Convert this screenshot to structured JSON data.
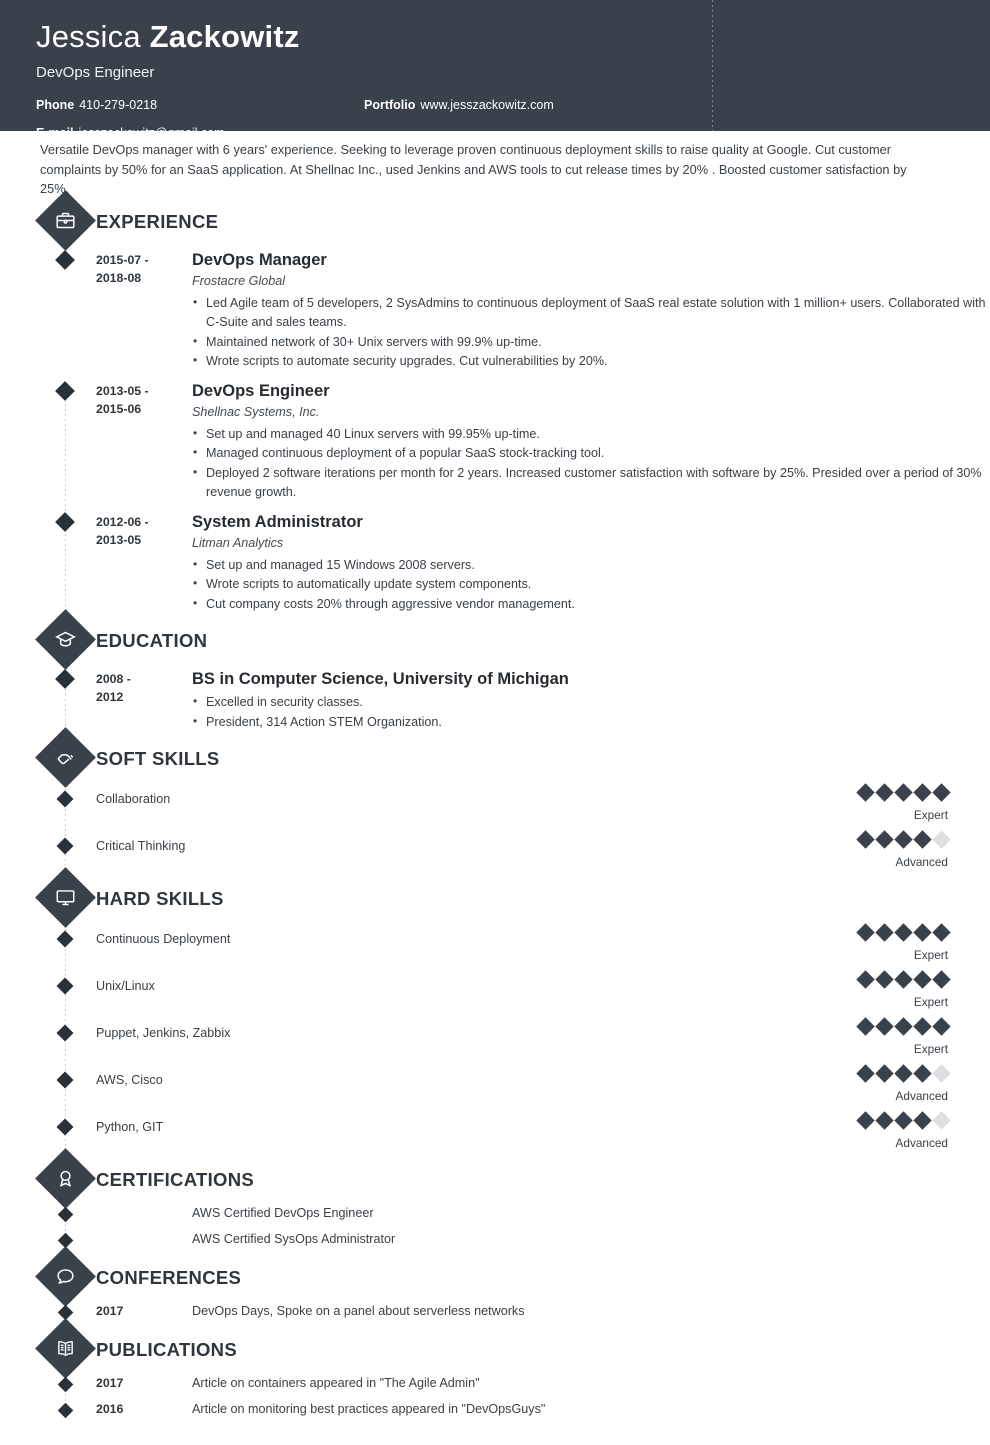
{
  "header": {
    "first_name": "Jessica ",
    "last_name": "Zackowitz",
    "job_title": "DevOps Engineer",
    "phone_label": "Phone",
    "phone_value": "410-279-0218",
    "portfolio_label": "Portfolio",
    "portfolio_value": "www.jesszackowitz.com",
    "email_label": "E-mail",
    "email_value": "jesszackowitz@gmail.com",
    "bg_color": "#39414b"
  },
  "summary": "Versatile DevOps manager with 6 years' experience. Seeking to leverage proven continuous deployment skills to raise quality at Google. Cut customer complaints by 50% for an SaaS application. At Shellnac Inc., used Jenkins and AWS tools to cut release times by 20% . Boosted customer satisfaction by 25%.",
  "sections": {
    "experience": {
      "title": "EXPERIENCE",
      "icon": "briefcase-icon",
      "entries": [
        {
          "date": "2015-07 - 2018-08",
          "role": "DevOps Manager",
          "company": "Frostacre Global",
          "points": [
            "Led Agile team of 5 developers, 2 SysAdmins to continuous deployment of SaaS real estate solution with 1 million+ users. Collaborated with C-Suite and sales teams.",
            "Maintained network of 30+ Unix servers with 99.9% up-time.",
            "Wrote scripts to automate security upgrades. Cut vulnerabilities by 20%."
          ]
        },
        {
          "date": "2013-05 - 2015-06",
          "role": "DevOps Engineer",
          "company": "Shellnac Systems, Inc.",
          "points": [
            "Set up and managed 40 Linux servers with 99.95% up-time.",
            "Managed continuous deployment of a popular SaaS stock-tracking tool.",
            "Deployed 2 software iterations per month for 2 years. Increased customer satisfaction with software by 25%. Presided over a period of 30% revenue growth."
          ]
        },
        {
          "date": "2012-06 - 2013-05",
          "role": "System Administrator",
          "company": "Litman Analytics",
          "points": [
            "Set up and managed 15 Windows 2008 servers.",
            "Wrote scripts to automatically update system components.",
            "Cut company costs 20% through aggressive vendor management."
          ]
        }
      ]
    },
    "education": {
      "title": "EDUCATION",
      "icon": "graduation-cap-icon",
      "entries": [
        {
          "date": "2008 - 2012",
          "degree": "BS in Computer Science, University of Michigan",
          "points": [
            "Excelled in security classes.",
            "President, 314 Action STEM Organization."
          ]
        }
      ]
    },
    "soft_skills": {
      "title": "SOFT SKILLS",
      "icon": "handshake-icon",
      "max_dots": 5,
      "items": [
        {
          "name": "Collaboration",
          "level": 5,
          "level_label": "Expert"
        },
        {
          "name": "Critical Thinking",
          "level": 4,
          "level_label": "Advanced"
        }
      ]
    },
    "hard_skills": {
      "title": "HARD SKILLS",
      "icon": "monitor-icon",
      "max_dots": 5,
      "items": [
        {
          "name": "Continuous Deployment",
          "level": 5,
          "level_label": "Expert"
        },
        {
          "name": "Unix/Linux",
          "level": 5,
          "level_label": "Expert"
        },
        {
          "name": "Puppet, Jenkins, Zabbix",
          "level": 5,
          "level_label": "Expert"
        },
        {
          "name": "AWS, Cisco",
          "level": 4,
          "level_label": "Advanced"
        },
        {
          "name": "Python, GIT",
          "level": 4,
          "level_label": "Advanced"
        }
      ]
    },
    "certifications": {
      "title": "CERTIFICATIONS",
      "icon": "award-ribbon-icon",
      "items": [
        {
          "year": "",
          "text": "AWS Certified DevOps Engineer"
        },
        {
          "year": "",
          "text": "AWS Certified SysOps Administrator"
        }
      ]
    },
    "conferences": {
      "title": "CONFERENCES",
      "icon": "speech-bubble-icon",
      "items": [
        {
          "year": "2017",
          "text": "DevOps Days, Spoke on a panel about serverless networks"
        }
      ]
    },
    "publications": {
      "title": "PUBLICATIONS",
      "icon": "open-book-icon",
      "items": [
        {
          "year": "2017",
          "text": "Article on containers appeared in \"The Agile Admin\""
        },
        {
          "year": "2016",
          "text": "Article on monitoring best practices appeared in \"DevOpsGuys\""
        }
      ]
    }
  }
}
